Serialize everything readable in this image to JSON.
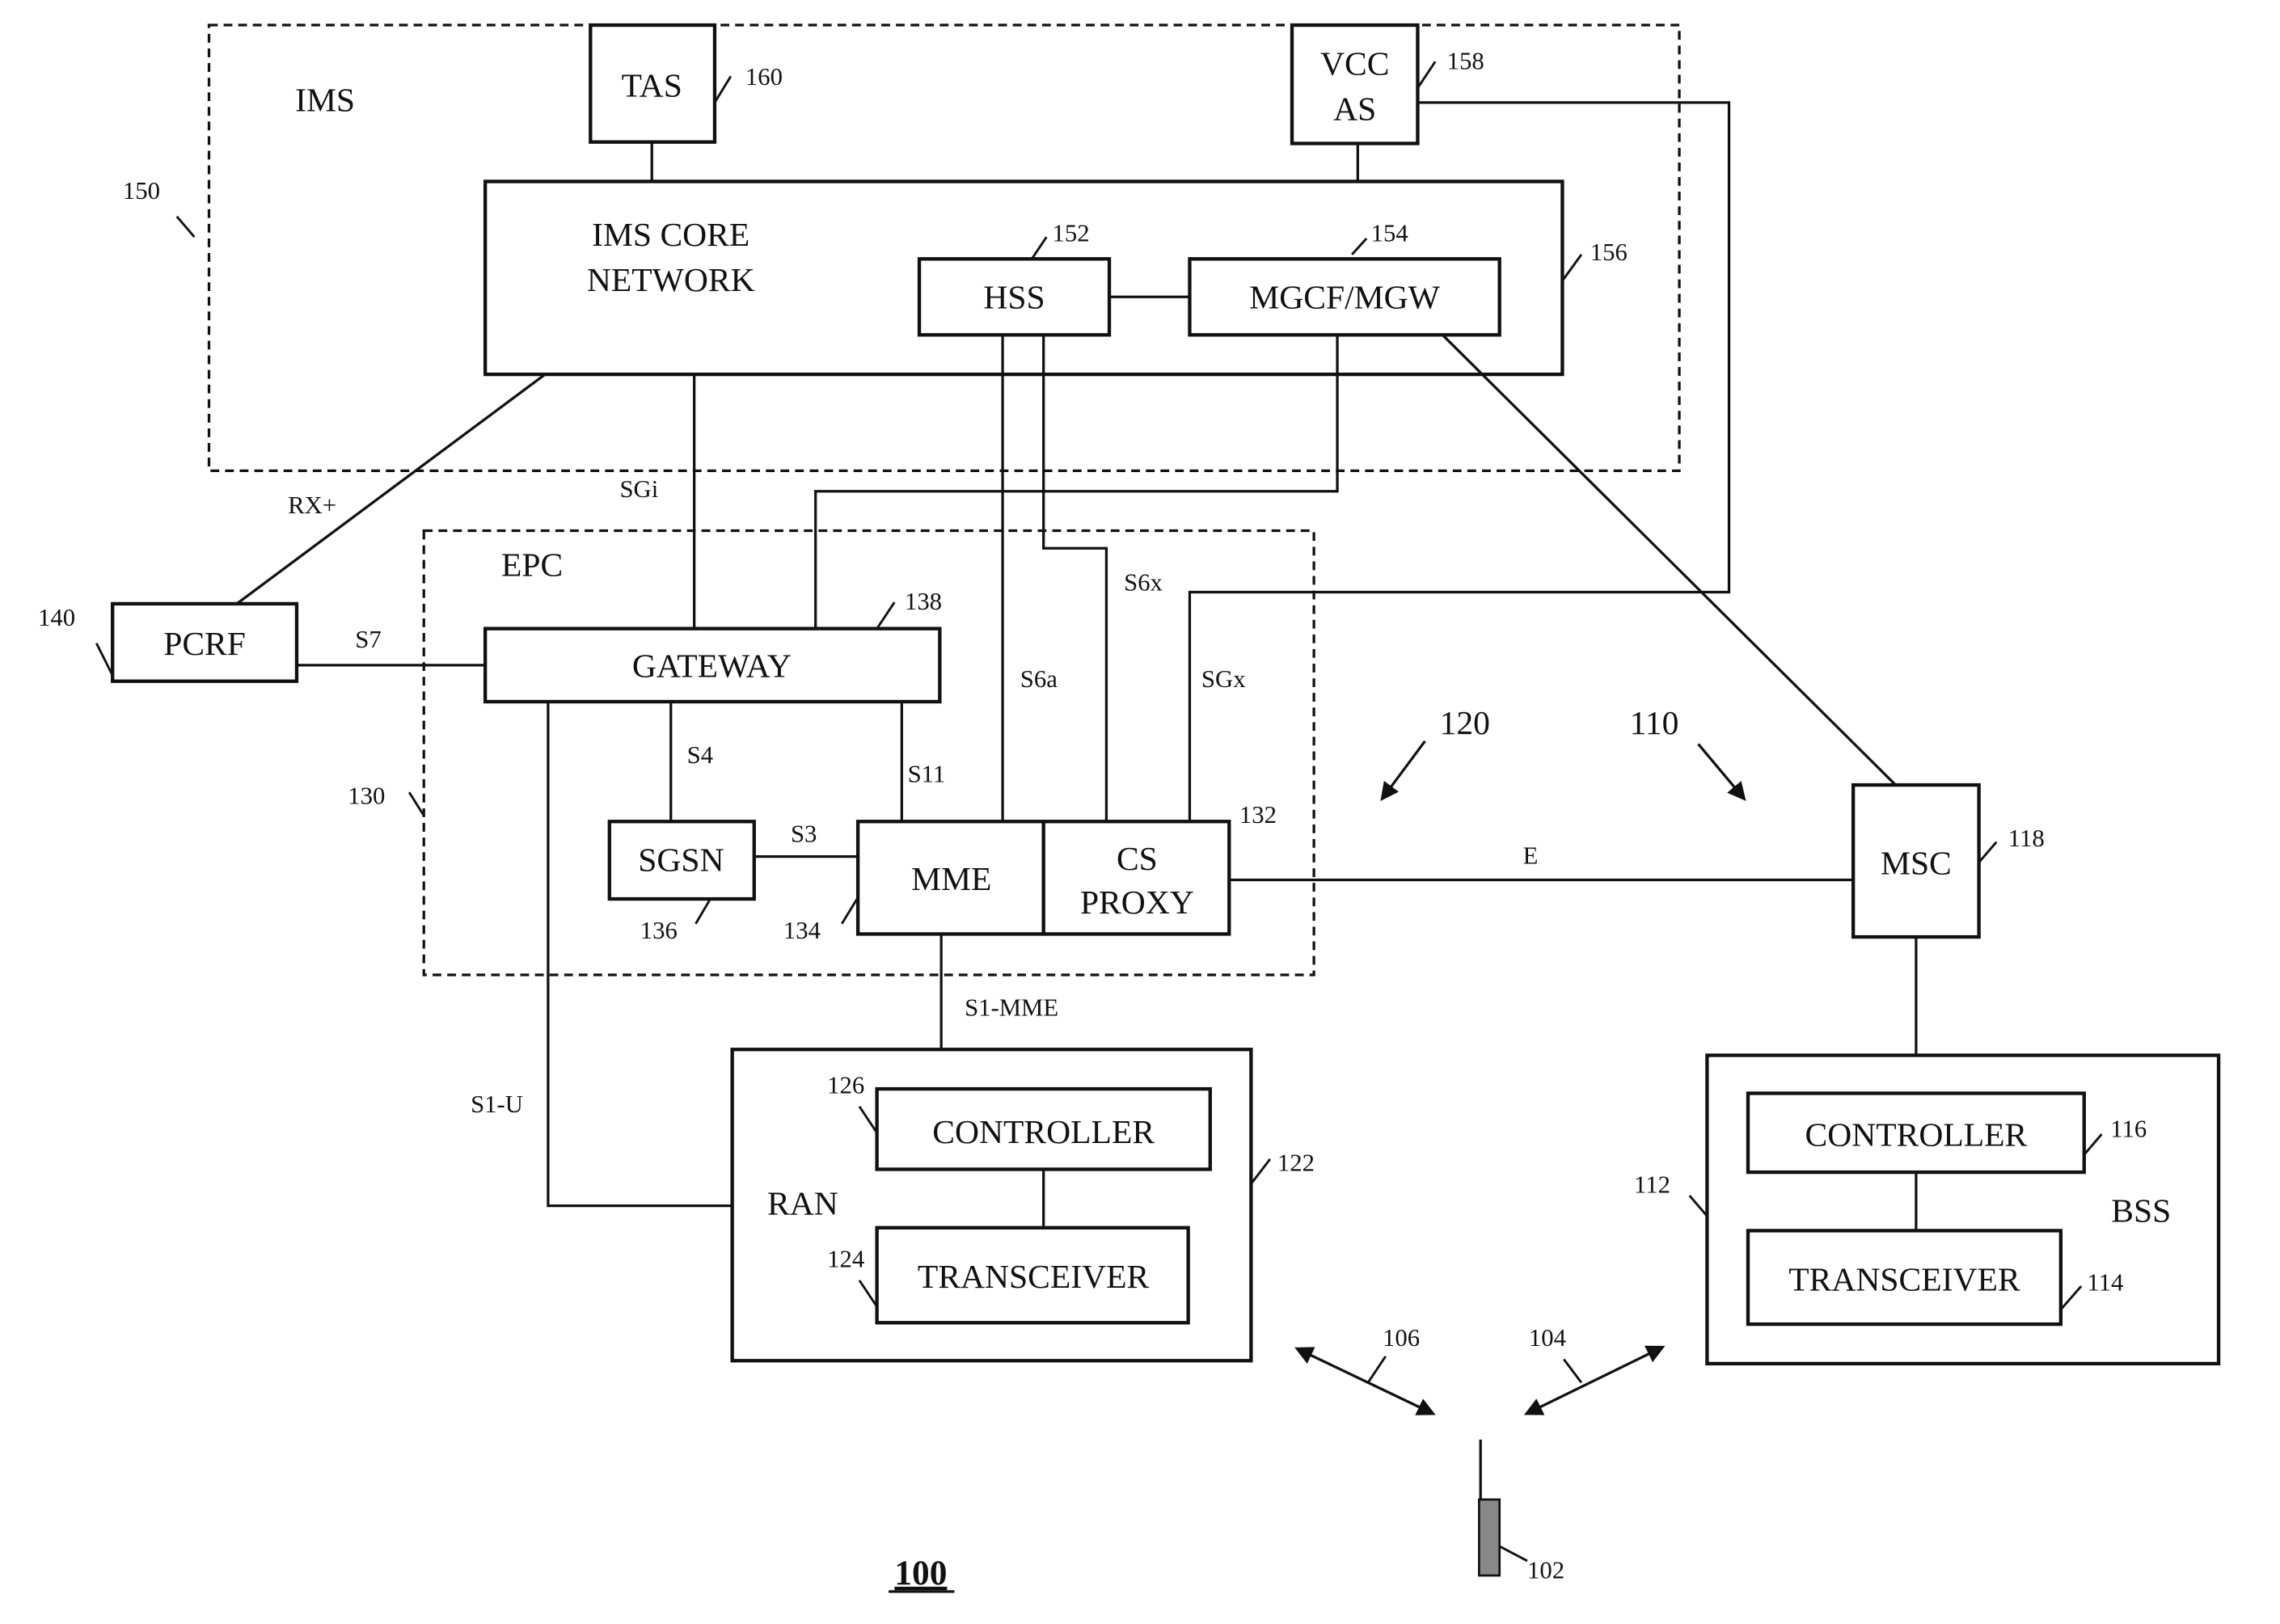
{
  "figure": {
    "number": "100",
    "ims": {
      "label": "IMS",
      "ref": "150"
    },
    "tas": {
      "label": "TAS",
      "ref": "160"
    },
    "vcc": {
      "line1": "VCC",
      "line2": "AS",
      "ref": "158"
    },
    "ims_core": {
      "line1": "IMS CORE",
      "line2": "NETWORK",
      "ref": "156"
    },
    "hss": {
      "label": "HSS",
      "ref": "152"
    },
    "mgcf": {
      "label": "MGCF/MGW",
      "ref": "154"
    },
    "epc": {
      "label": "EPC",
      "ref": "130"
    },
    "pcrf": {
      "label": "PCRF",
      "ref": "140"
    },
    "gateway": {
      "label": "GATEWAY",
      "ref": "138"
    },
    "sgsn": {
      "label": "SGSN",
      "ref": "136"
    },
    "mme": {
      "label": "MME",
      "ref": "134"
    },
    "cs_proxy": {
      "line1": "CS",
      "line2": "PROXY",
      "ref": "132"
    },
    "msc": {
      "label": "MSC",
      "ref": "118"
    },
    "ran": {
      "label": "RAN",
      "ref": "122",
      "controller": {
        "label": "CONTROLLER",
        "ref": "126"
      },
      "transceiver": {
        "label": "TRANSCEIVER",
        "ref": "124"
      }
    },
    "bss": {
      "label": "BSS",
      "ref": "112",
      "controller": {
        "label": "CONTROLLER",
        "ref": "116"
      },
      "transceiver": {
        "label": "TRANSCEIVER",
        "ref": "114"
      }
    },
    "device": {
      "ref": "102"
    },
    "links": {
      "rx": "RX+",
      "sgi": "SGi",
      "s7": "S7",
      "s4": "S4",
      "s3": "S3",
      "s11": "S11",
      "s6a": "S6a",
      "s6x": "S6x",
      "sgx": "SGx",
      "e": "E",
      "s1mme": "S1-MME",
      "s1u": "S1-U"
    },
    "arrows": {
      "lte": "120",
      "legacy": "110",
      "link_ran": "106",
      "link_bss": "104"
    }
  }
}
